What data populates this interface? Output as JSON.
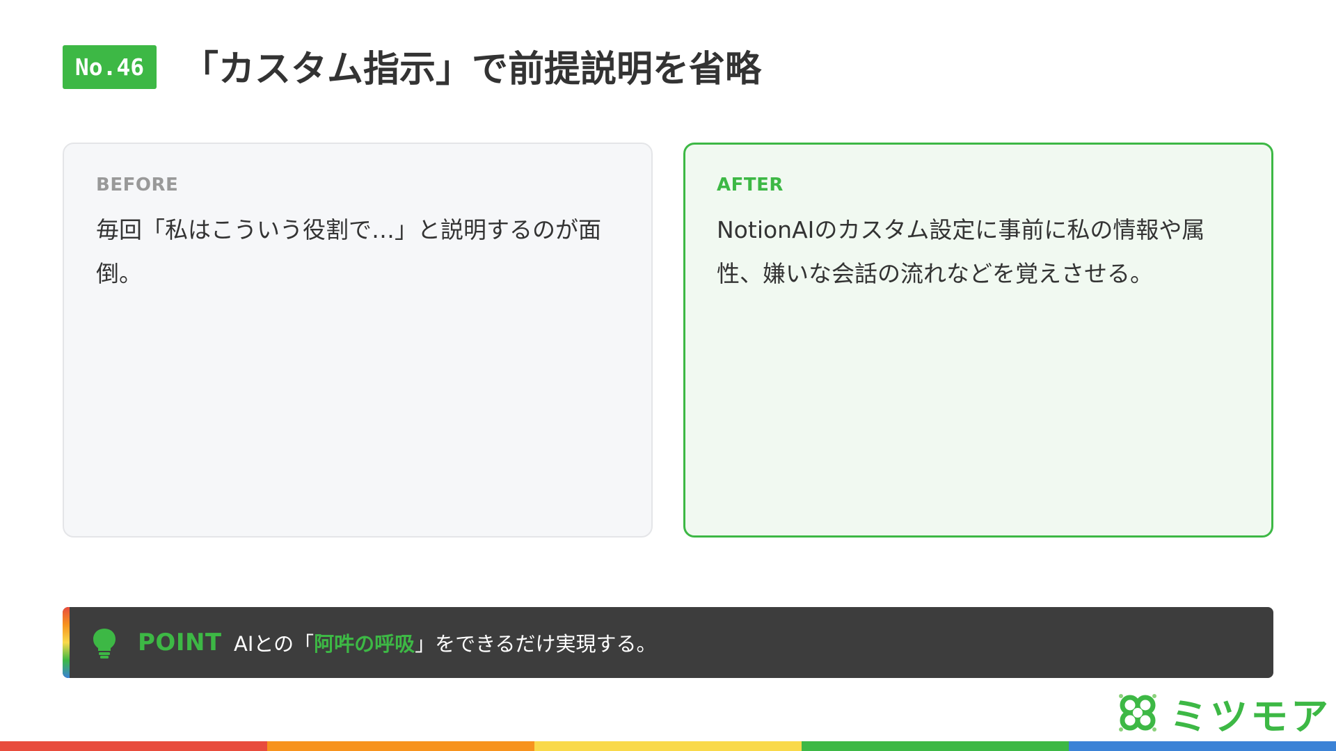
{
  "badge": "No.46",
  "title": "「カスタム指示」で前提説明を省略",
  "before": {
    "label": "BEFORE",
    "text": "毎回「私はこういう役割で…」と説明するのが面倒。"
  },
  "after": {
    "label": "AFTER",
    "text": "NotionAIのカスタム設定に事前に私の情報や属性、嫌いな会話の流れなどを覚えさせる。"
  },
  "point": {
    "icon": "lightbulb-icon",
    "label": "POINT",
    "text_pre": "AIとの「",
    "text_highlight": "阿吽の呼吸",
    "text_post": "」をできるだけ実現する。"
  },
  "logo": {
    "icon": "clover-logo-icon",
    "text": "ミツモア"
  },
  "colors": {
    "accent": "#3db845",
    "dark_bar": "#3d3d3d",
    "stripe": [
      "#e84c3d",
      "#f7931e",
      "#f9d94a",
      "#3db845",
      "#3b82d6"
    ]
  }
}
